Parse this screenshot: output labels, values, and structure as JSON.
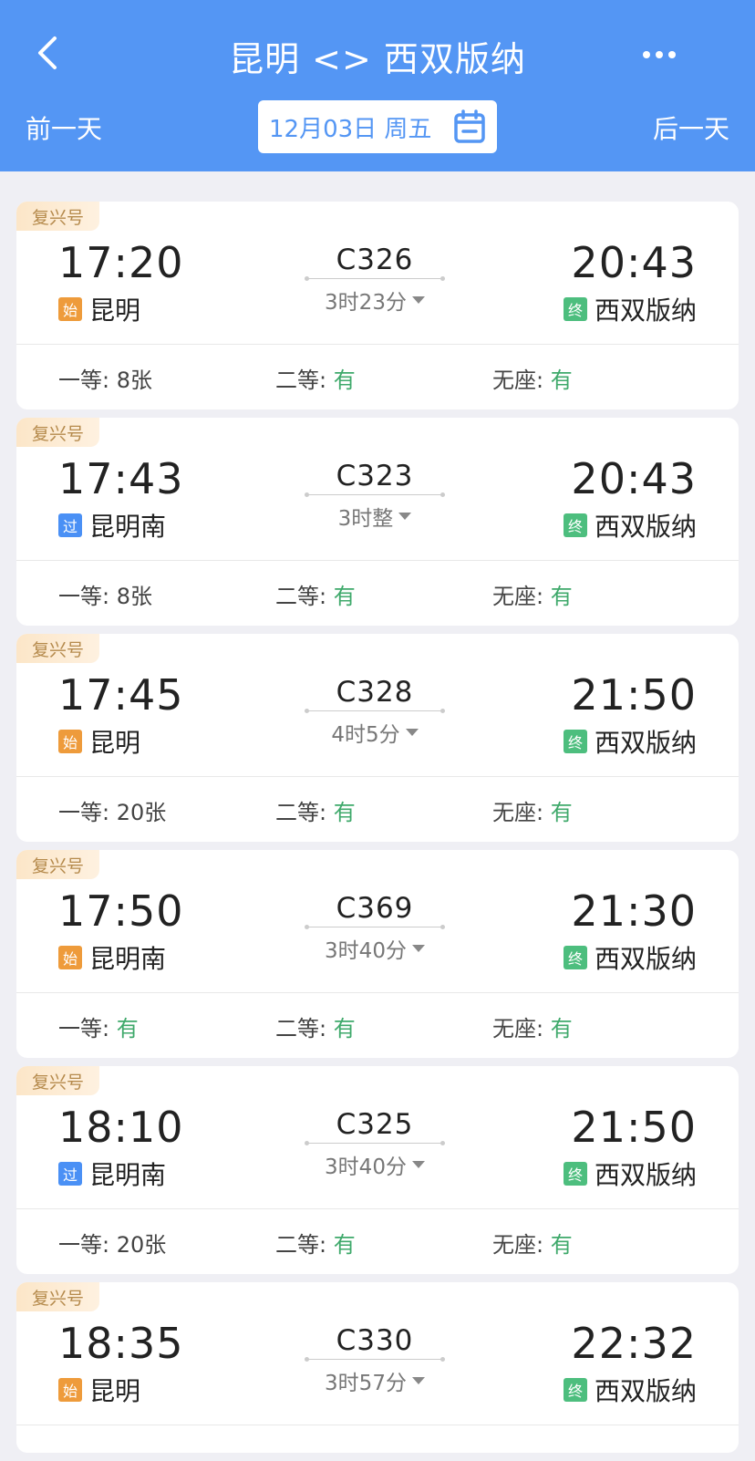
{
  "header": {
    "title": "昆明 <> 西双版纳",
    "prev_day": "前一天",
    "next_day": "后一天",
    "date": "12月03日 周五",
    "back_icon": "chevron-left-icon",
    "more_icon": "more-dots-icon",
    "calendar_icon": "calendar-icon"
  },
  "colors": {
    "header_bg": "#5496F4",
    "start_badge": "#EE9B3B",
    "pass_badge": "#4A90F5",
    "end_badge": "#4DBE7E",
    "available": "#3FA96B"
  },
  "trains": [
    {
      "tag": "复兴号",
      "dep_time": "17:20",
      "dep_badge": "始",
      "dep_badge_type": "start",
      "dep_station": "昆明",
      "train_no": "C326",
      "duration": "3时23分",
      "arr_time": "20:43",
      "arr_badge": "终",
      "arr_station": "西双版纳",
      "seats": [
        {
          "label": "一等:",
          "value": "8张",
          "green": false
        },
        {
          "label": "二等:",
          "value": "有",
          "green": true
        },
        {
          "label": "无座:",
          "value": "有",
          "green": true
        }
      ]
    },
    {
      "tag": "复兴号",
      "dep_time": "17:43",
      "dep_badge": "过",
      "dep_badge_type": "pass",
      "dep_station": "昆明南",
      "train_no": "C323",
      "duration": "3时整",
      "arr_time": "20:43",
      "arr_badge": "终",
      "arr_station": "西双版纳",
      "seats": [
        {
          "label": "一等:",
          "value": "8张",
          "green": false
        },
        {
          "label": "二等:",
          "value": "有",
          "green": true
        },
        {
          "label": "无座:",
          "value": "有",
          "green": true
        }
      ]
    },
    {
      "tag": "复兴号",
      "dep_time": "17:45",
      "dep_badge": "始",
      "dep_badge_type": "start",
      "dep_station": "昆明",
      "train_no": "C328",
      "duration": "4时5分",
      "arr_time": "21:50",
      "arr_badge": "终",
      "arr_station": "西双版纳",
      "seats": [
        {
          "label": "一等:",
          "value": "20张",
          "green": false
        },
        {
          "label": "二等:",
          "value": "有",
          "green": true
        },
        {
          "label": "无座:",
          "value": "有",
          "green": true
        }
      ]
    },
    {
      "tag": "复兴号",
      "dep_time": "17:50",
      "dep_badge": "始",
      "dep_badge_type": "start",
      "dep_station": "昆明南",
      "train_no": "C369",
      "duration": "3时40分",
      "arr_time": "21:30",
      "arr_badge": "终",
      "arr_station": "西双版纳",
      "seats": [
        {
          "label": "一等:",
          "value": "有",
          "green": true
        },
        {
          "label": "二等:",
          "value": "有",
          "green": true
        },
        {
          "label": "无座:",
          "value": "有",
          "green": true
        }
      ]
    },
    {
      "tag": "复兴号",
      "dep_time": "18:10",
      "dep_badge": "过",
      "dep_badge_type": "pass",
      "dep_station": "昆明南",
      "train_no": "C325",
      "duration": "3时40分",
      "arr_time": "21:50",
      "arr_badge": "终",
      "arr_station": "西双版纳",
      "seats": [
        {
          "label": "一等:",
          "value": "20张",
          "green": false
        },
        {
          "label": "二等:",
          "value": "有",
          "green": true
        },
        {
          "label": "无座:",
          "value": "有",
          "green": true
        }
      ]
    },
    {
      "tag": "复兴号",
      "dep_time": "18:35",
      "dep_badge": "始",
      "dep_badge_type": "start",
      "dep_station": "昆明",
      "train_no": "C330",
      "duration": "3时57分",
      "arr_time": "22:32",
      "arr_badge": "终",
      "arr_station": "西双版纳",
      "seats": []
    }
  ]
}
